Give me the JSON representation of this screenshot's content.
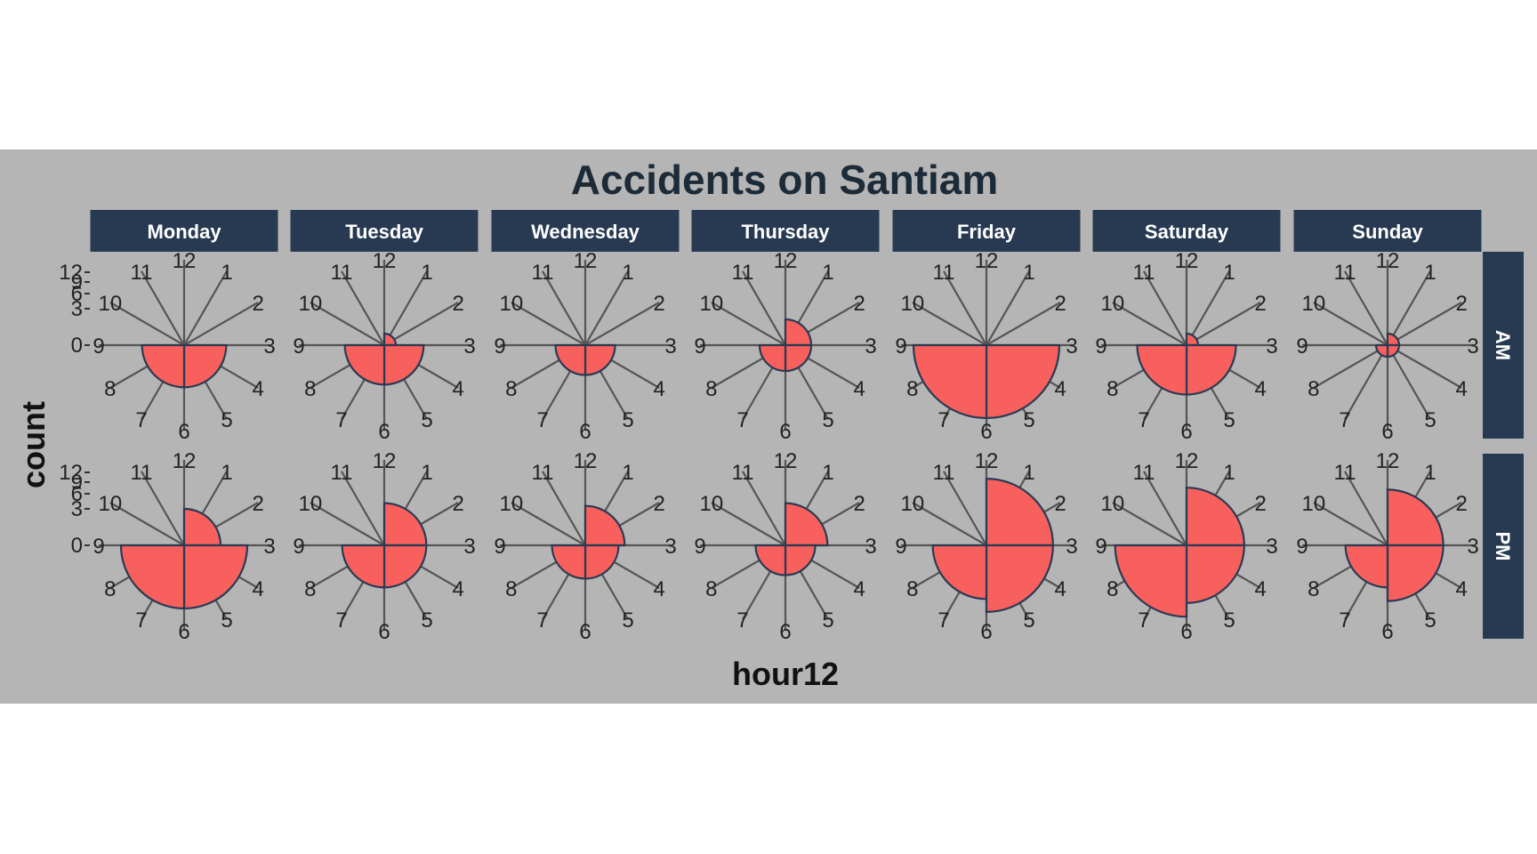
{
  "chart_data": {
    "type": "polar-bar",
    "title": "Accidents on Santiam",
    "xlabel": "hour12",
    "ylabel": "count",
    "columns": [
      "Monday",
      "Tuesday",
      "Wednesday",
      "Thursday",
      "Friday",
      "Saturday",
      "Sunday"
    ],
    "rows": [
      "AM",
      "PM"
    ],
    "hour_labels": [
      "12",
      "1",
      "2",
      "3",
      "4",
      "5",
      "6",
      "7",
      "8",
      "9",
      "10",
      "11"
    ],
    "radial_ticks": [
      "0",
      "3",
      "6",
      "9",
      "12"
    ],
    "rlim": [
      0,
      12
    ],
    "fill_color": "#f8605e",
    "stroke_color": "#2a3a52",
    "panel_bg": "#b5b5b5",
    "strip_bg": "#283a52",
    "strip_text_color": "#ffffff",
    "data": {
      "AM": {
        "Monday": {
          "3": 0,
          "6": 4,
          "9": 4
        },
        "Tuesday": {
          "3": 0.3,
          "6": 3.5,
          "9": 3.5
        },
        "Wednesday": {
          "3": 0,
          "6": 2,
          "9": 2
        },
        "Thursday": {
          "3": 1.5,
          "6": 1.5,
          "9": 1.5
        },
        "Friday": {
          "3": 0,
          "6": 12,
          "9": 12
        },
        "Saturday": {
          "3": 0.3,
          "6": 5.5,
          "9": 5.5
        },
        "Sunday": {
          "3": 0.3,
          "6": 0.3,
          "9": 0.3
        }
      },
      "PM": {
        "Monday": {
          "3": 3,
          "6": 9,
          "9": 9
        },
        "Tuesday": {
          "3": 4,
          "6": 4,
          "9": 4
        },
        "Wednesday": {
          "3": 3.5,
          "6": 2.5,
          "9": 2.5
        },
        "Thursday": {
          "3": 4,
          "6": 2,
          "9": 2
        },
        "Friday": {
          "3": 10,
          "6": 10,
          "9": 6.5
        },
        "Saturday": {
          "3": 7.5,
          "6": 7.5,
          "9": 11.5
        },
        "Sunday": {
          "3": 7,
          "6": 7,
          "9": 4
        }
      }
    }
  }
}
